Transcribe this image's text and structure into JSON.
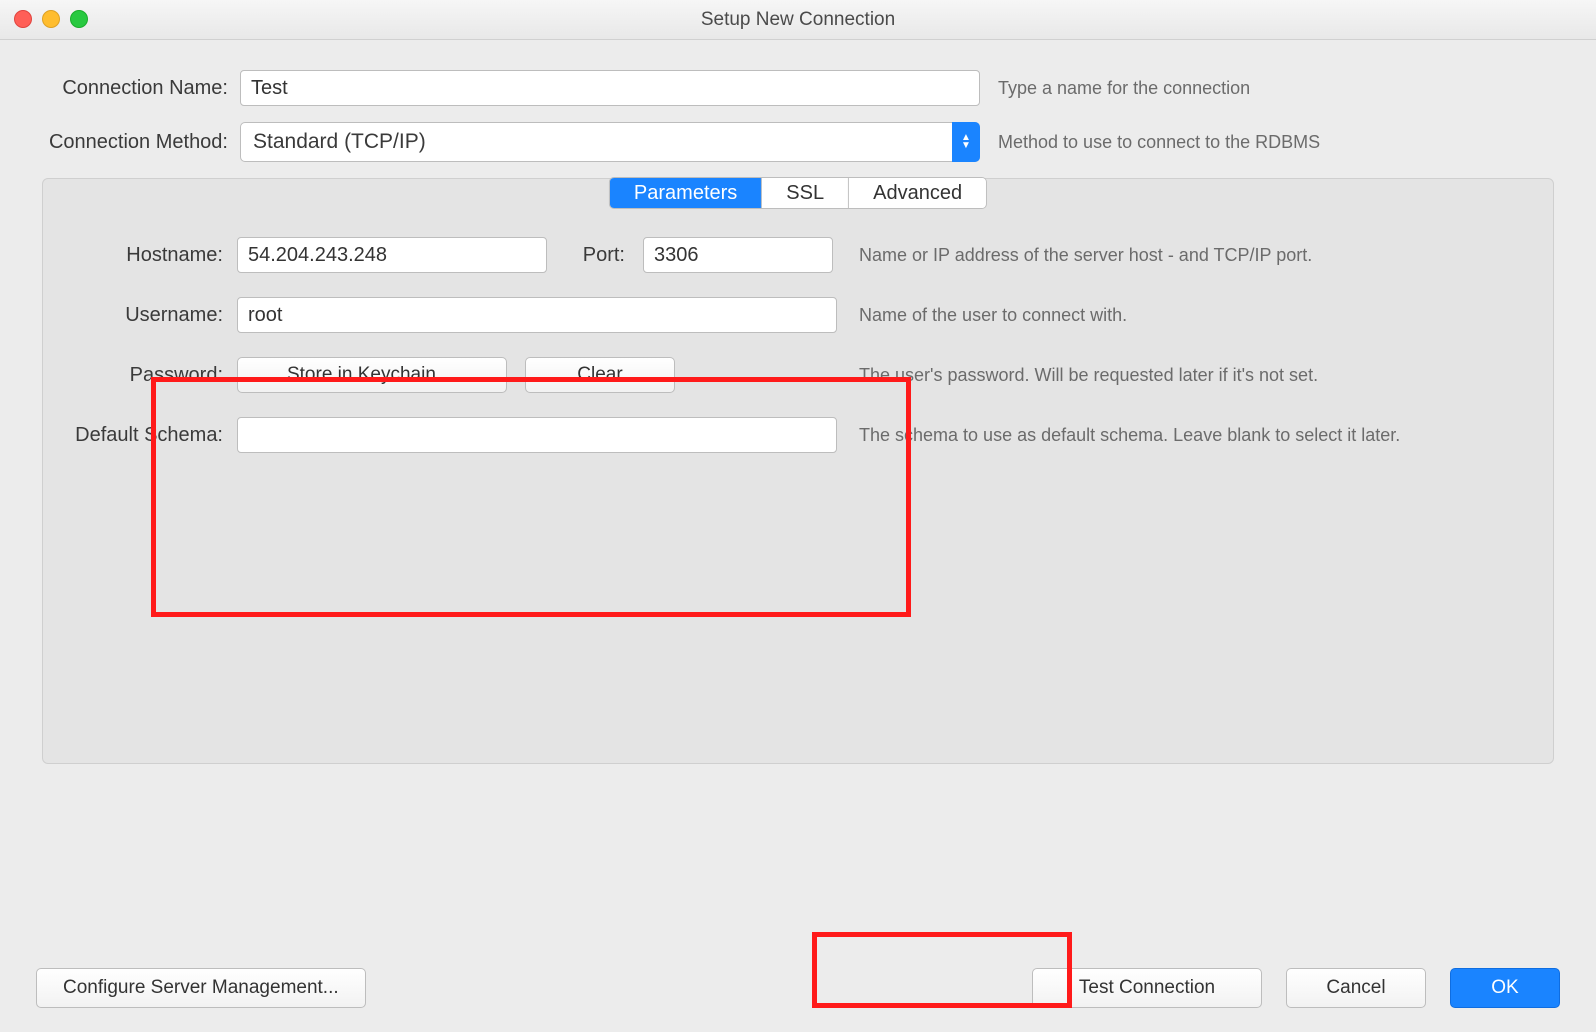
{
  "window": {
    "title": "Setup New Connection"
  },
  "fields": {
    "connection_name": {
      "label": "Connection Name:",
      "value": "Test",
      "hint": "Type a name for the connection"
    },
    "connection_method": {
      "label": "Connection Method:",
      "value": "Standard (TCP/IP)",
      "hint": "Method to use to connect to the RDBMS"
    }
  },
  "tabs": {
    "parameters": "Parameters",
    "ssl": "SSL",
    "advanced": "Advanced"
  },
  "params": {
    "hostname": {
      "label": "Hostname:",
      "value": "54.204.243.248"
    },
    "port": {
      "label": "Port:",
      "value": "3306"
    },
    "host_hint": "Name or IP address of the server host - and TCP/IP port.",
    "username": {
      "label": "Username:",
      "value": "root",
      "hint": "Name of the user to connect with."
    },
    "password": {
      "label": "Password:",
      "store_btn": "Store in Keychain ...",
      "clear_btn": "Clear",
      "hint": "The user's password. Will be requested later if it's not set."
    },
    "default_schema": {
      "label": "Default Schema:",
      "value": "",
      "hint": "The schema to use as default schema. Leave blank to select it later."
    }
  },
  "footer": {
    "configure": "Configure Server Management...",
    "test": "Test Connection",
    "cancel": "Cancel",
    "ok": "OK"
  }
}
